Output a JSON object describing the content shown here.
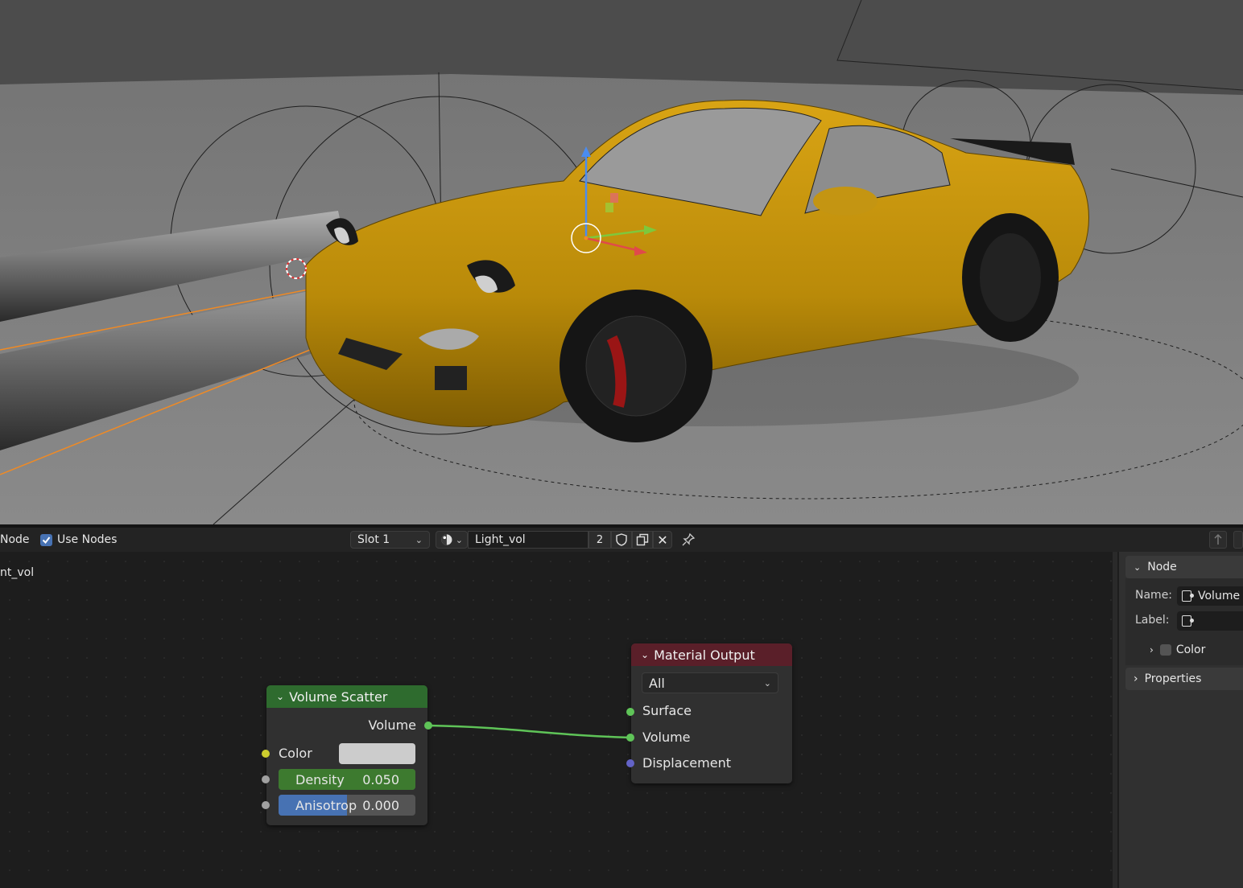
{
  "header": {
    "editor_type": "Node",
    "use_nodes_label": "Use Nodes",
    "use_nodes_checked": true,
    "slot": "Slot 1",
    "material_name": "Light_vol",
    "user_count": "2"
  },
  "breadcrumb": "nt_vol",
  "nodes": {
    "volume_scatter": {
      "title": "Volume Scatter",
      "output_volume": "Volume",
      "color_label": "Color",
      "density_label": "Density",
      "density_value": "0.050",
      "anisotropy_label": "Anisotrop",
      "anisotropy_value": "0.000",
      "header_color": "#2e6b2e"
    },
    "material_output": {
      "title": "Material Output",
      "target": "All",
      "surface": "Surface",
      "volume": "Volume",
      "displacement": "Displacement",
      "header_color": "#5a1f29"
    }
  },
  "sidebar": {
    "node_panel": "Node",
    "name_label": "Name:",
    "name_value": "Volume",
    "label_label": "Label:",
    "color_label": "Color",
    "properties_panel": "Properties"
  }
}
